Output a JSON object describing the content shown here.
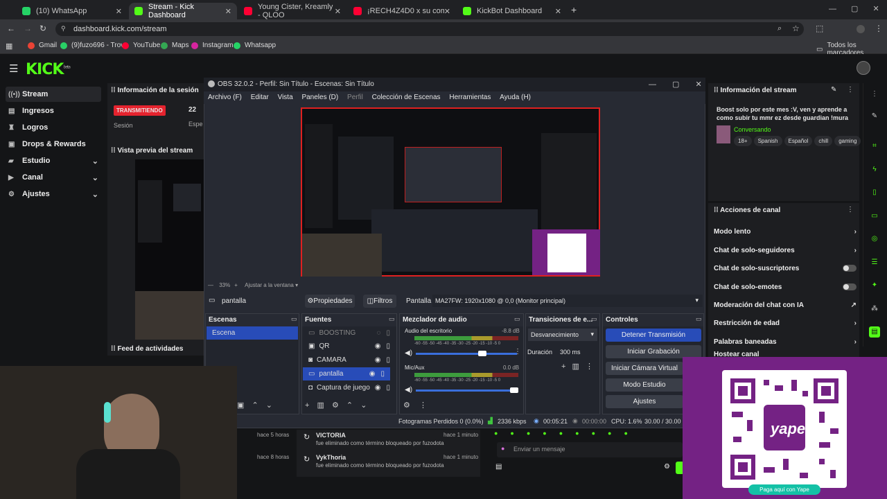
{
  "browser": {
    "tabs": [
      {
        "title": "(10) WhatsApp",
        "color": "#25d366"
      },
      {
        "title": "Stream - Kick Dashboard",
        "color": "#53fc18",
        "active": true
      },
      {
        "title": "Young Cister, Kreamly - QLOO",
        "color": "#ff0033"
      },
      {
        "title": "¡RECH4Z4D0 x su comunida",
        "color": "#ff0033"
      },
      {
        "title": "KickBot Dashboard",
        "color": "#53fc18"
      }
    ],
    "url": "dashboard.kick.com/stream",
    "bookmarks": [
      "Gmail",
      "(9)fuzo696 - Trovo",
      "YouTube",
      "Maps",
      "Instagram",
      "Whatsapp"
    ],
    "bookmarks_all": "Todos los marcadores"
  },
  "kick": {
    "logo": "KICK",
    "logo_sup": "beta",
    "nav": [
      {
        "label": "Stream",
        "icon": "stream-icon"
      },
      {
        "label": "Ingresos",
        "icon": "money-icon"
      },
      {
        "label": "Logros",
        "icon": "trophy-icon"
      },
      {
        "label": "Drops & Rewards",
        "icon": "gift-icon"
      },
      {
        "label": "Estudio",
        "icon": "studio-icon",
        "chev": true
      },
      {
        "label": "Canal",
        "icon": "channel-icon",
        "chev": true
      },
      {
        "label": "Ajustes",
        "icon": "gear-icon",
        "chev": true
      }
    ],
    "session": {
      "title": "Información de la sesión",
      "status": "TRANSMITIENDO",
      "label": "Sesión",
      "count": "22",
      "count_label": "Espe"
    },
    "preview_title": "Vista previa del stream",
    "feed_title": "Feed de actividades",
    "feed": [
      {
        "ago": "hace 5 horas",
        "user": "VICTORIA",
        "msg": "fue eliminado como término bloqueado por fuzodota",
        "time": "hace 1 minuto"
      },
      {
        "ago": "hace 8 horas",
        "user": "VykThoria",
        "msg": "fue eliminado como término bloqueado por fuzodota",
        "time": "hace 1 minuto"
      }
    ],
    "chat_placeholder": "Enviar un mensaje",
    "stream_info": {
      "title": "Información del stream",
      "stream_title": "Boost solo por este mes :V, ven y aprende a como subir tu mmr ez desde guardian !mura !i...",
      "category": "Conversando",
      "tags": [
        "18+",
        "Spanish",
        "Español",
        "chill",
        "gaming"
      ]
    },
    "actions": {
      "title": "Acciones de canal",
      "items": [
        {
          "label": "Modo lento",
          "type": "chev"
        },
        {
          "label": "Chat de solo-seguidores",
          "type": "chev"
        },
        {
          "label": "Chat de solo-suscriptores",
          "type": "toggle"
        },
        {
          "label": "Chat de solo-emotes",
          "type": "toggle"
        },
        {
          "label": "Moderación del chat con IA",
          "type": "ext"
        },
        {
          "label": "Restricción de edad",
          "type": "chev"
        },
        {
          "label": "Palabras baneadas",
          "type": "chev"
        },
        {
          "label": "Hostear canal",
          "type": "none"
        }
      ]
    },
    "yape_button": "Paga aquí con Yape",
    "yape_logo": "yape"
  },
  "obs": {
    "title": "OBS 32.0.2 - Perfil: Sin Título - Escenas: Sin Título",
    "menu": [
      "Archivo (F)",
      "Editar",
      "Vista",
      "Paneles (D)",
      "Perfil",
      "Colección de Escenas",
      "Herramientas",
      "Ayuda (H)"
    ],
    "zoom": "33%",
    "fit": "Ajustar a la ventana",
    "source_bar": {
      "name": "pantalla",
      "props": "Propiedades",
      "filters": "Filtros",
      "label": "Pantalla",
      "value": "MA27FW: 1920x1080 @ 0,0 (Monitor principal)"
    },
    "scenes": {
      "title": "Escenas",
      "items": [
        "Escena"
      ]
    },
    "sources": {
      "title": "Fuentes",
      "items": [
        "BOOSTING",
        "QR",
        "CAMARA",
        "pantalla",
        "Captura de juego"
      ],
      "selected": "pantalla"
    },
    "mixer": {
      "title": "Mezclador de audio",
      "channels": [
        {
          "name": "Audio del escritorio",
          "db": "-8.8 dB",
          "scale": "-60 -55 -50 -45 -40 -35 -30 -25 -20 -15 -10 -5 0"
        },
        {
          "name": "Mic/Aux",
          "db": "0.0 dB",
          "scale": "-60 -55 -50 -45 -40 -35 -30 -25 -20 -15 -10 -5 0"
        }
      ]
    },
    "transitions": {
      "title": "Transiciones de e...",
      "type": "Desvanecimiento",
      "duration_label": "Duración",
      "duration": "300 ms"
    },
    "controls": {
      "title": "Controles",
      "buttons": [
        "Detener Transmisión",
        "Iniciar Grabación",
        "Iniciar Cámara Virtual",
        "Modo Estudio",
        "Ajustes"
      ]
    },
    "status": {
      "dropped": "Fotogramas Perdidos 0 (0.0%)",
      "kbps": "2336 kbps",
      "live": "00:05:21",
      "rec": "00:00:00",
      "cpu": "CPU: 1.6%",
      "fps": "30.00 / 30.00 F"
    }
  }
}
